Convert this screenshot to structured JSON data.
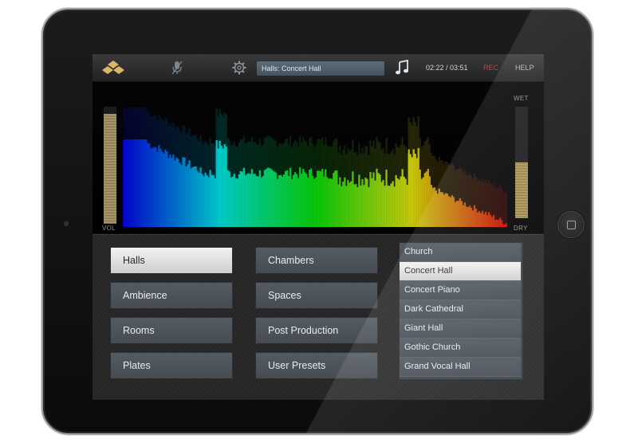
{
  "topbar": {
    "preset_field": "Halls: Concert Hall",
    "time": "02:22 / 03:51",
    "rec_label": "REC",
    "help_label": "HELP",
    "icons": [
      "logo-icon",
      "mic-off-icon",
      "gear-icon",
      "music-note-icon"
    ]
  },
  "meters": {
    "vol_label": "VOL",
    "wet_label": "WET",
    "dry_label": "DRY",
    "vol_level": 0.94,
    "wet_level": 0.5
  },
  "categories": {
    "col1": [
      "Halls",
      "Ambience",
      "Rooms",
      "Plates"
    ],
    "col2": [
      "Chambers",
      "Spaces",
      "Post Production",
      "User Presets"
    ],
    "selected": "Halls"
  },
  "presets": {
    "items": [
      "Church",
      "Concert Hall",
      "Concert Piano",
      "Dark Cathedral",
      "Giant Hall",
      "Gothic Church",
      "Grand Vocal Hall"
    ],
    "selected": "Concert Hall"
  },
  "colors": {
    "accent_rec": "#d23b3b",
    "meter_gold": "#bca66b",
    "button_gray": "#4e555b",
    "selected_white": "#e8e8e8"
  }
}
